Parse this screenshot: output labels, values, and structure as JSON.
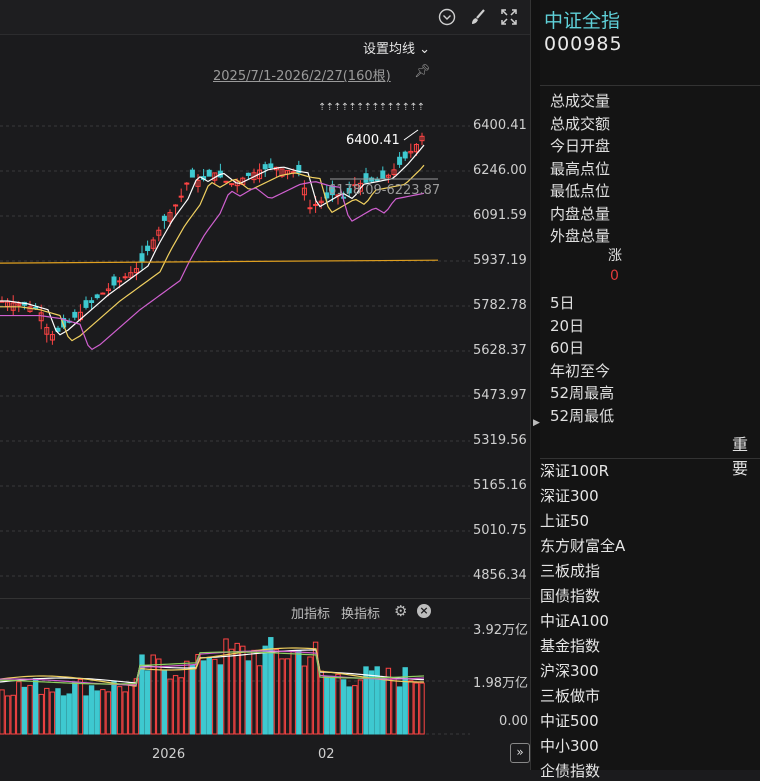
{
  "toolbar": {
    "icons": [
      "chevron-down-circle-icon",
      "brush-icon",
      "fullscreen-icon"
    ]
  },
  "chart": {
    "set_ma_label": "设置均线",
    "range_label": "2025/7/1-2026/2/27(160根)",
    "price_axis": [
      "6400.41",
      "6246.00",
      "6091.59",
      "5937.19",
      "5782.78",
      "5628.37",
      "5473.97",
      "5319.56",
      "5165.16",
      "5010.75",
      "4856.34"
    ],
    "high_annotation": "6400.41",
    "range_annotation": "6178.09-6223.87",
    "volume_axis": [
      "3.92万亿",
      "1.98万亿",
      "0.00"
    ],
    "add_indicator": "加指标",
    "swap_indicator": "换指标",
    "x_labels": [
      "2026",
      "02"
    ],
    "colors": {
      "up": "#ff4444",
      "down": "#3ec9d0",
      "ma5": "#ffffff",
      "ma10": "#f0d060",
      "ma20": "#d060d0",
      "hline": "#e0a020"
    }
  },
  "sidebar": {
    "index_name": "中证全指",
    "index_code": "000985",
    "info_rows": [
      "总成交量",
      "总成交额",
      "今日开盘",
      "最高点位",
      "最低点位",
      "内盘总量",
      "外盘总量"
    ],
    "rise_label": "涨",
    "rise_value": "0",
    "perf_rows": [
      "5日",
      "20日",
      "60日",
      "年初至今",
      "52周最高",
      "52周最低"
    ],
    "section_title": "重要",
    "indices": [
      "深证100R",
      "深证300",
      "上证50",
      "东方财富全A",
      "三板成指",
      "国债指数",
      "中证A100",
      "基金指数",
      "沪深300",
      "三板做市",
      "中证500",
      "中小300",
      "企债指数"
    ]
  }
}
